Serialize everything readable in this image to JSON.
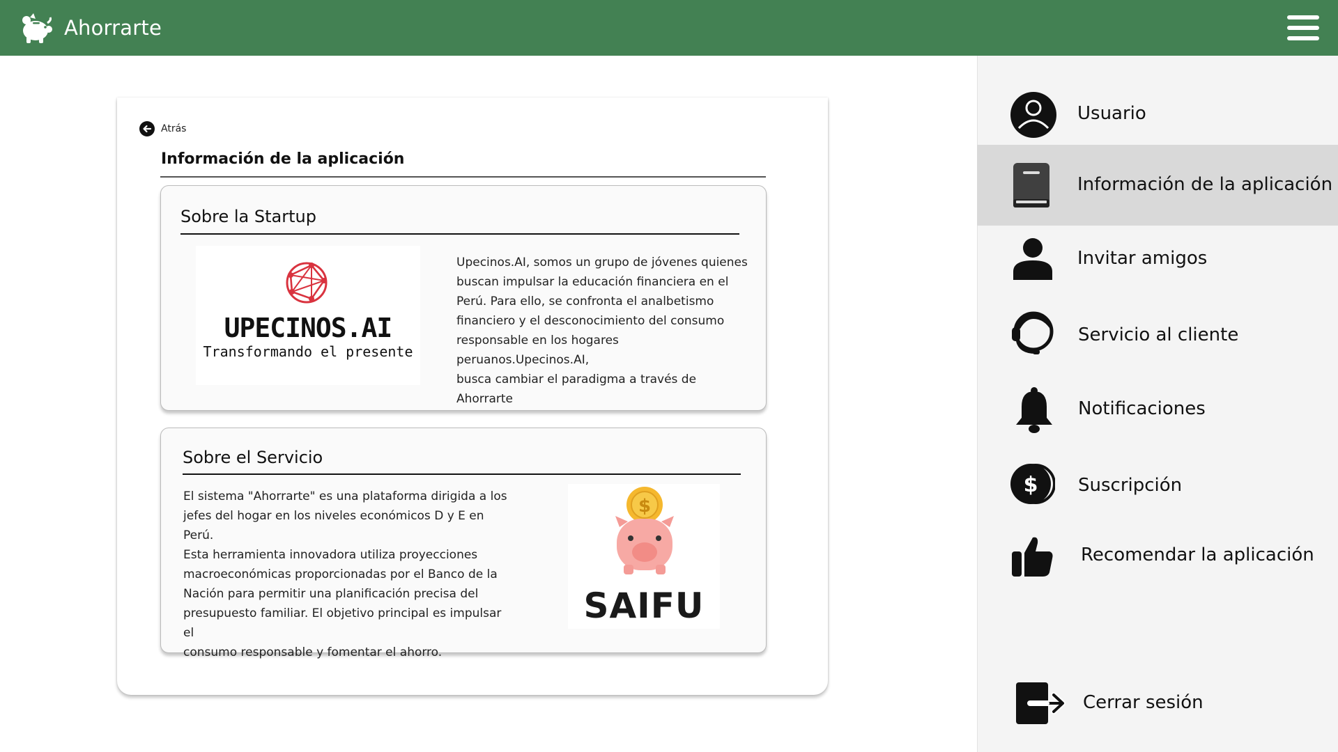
{
  "app": {
    "title": "Ahorrarte",
    "accent_color": "#438153"
  },
  "header": {
    "menu_icon": "hamburger-menu-icon"
  },
  "main": {
    "back_label": "Atrás",
    "page_title": "Información de la aplicación",
    "startup": {
      "title": "Sobre la Startup",
      "text_lines": [
        "Upecinos.AI, somos un grupo de jóvenes quienes",
        "buscan impulsar la educación financiera en el",
        "Perú. Para ello, se confronta el analbetismo",
        "financiero y el desconocimiento del consumo",
        "responsable en los hogares peruanos.Upecinos.AI,",
        "busca cambiar el paradigma a través de Ahorrarte"
      ],
      "logo": {
        "name": "UPECINOS.AI",
        "tagline": "Transformando el presente",
        "globe_color": "#d9333f"
      }
    },
    "service": {
      "title": "Sobre el Servicio",
      "text_lines": [
        "El sistema \"Ahorrarte\" es una plataforma dirigida a los",
        "jefes del hogar en los niveles económicos D y E en Perú.",
        "Esta herramienta innovadora utiliza proyecciones",
        "macroeconómicas proporcionadas por el Banco de la",
        "Nación para permitir una planificación precisa del",
        "presupuesto familiar. El objetivo principal es impulsar el",
        "consumo responsable y fomentar el ahorro."
      ],
      "logo": {
        "name": "SAIFU",
        "coin_symbol": "$",
        "pig_color": "#f7a9a4",
        "coin_color": "#f5b82e"
      }
    }
  },
  "sidebar": {
    "items": [
      {
        "label": "Usuario",
        "icon": "user-circle-icon",
        "active": false
      },
      {
        "label": "Información de la aplicación",
        "icon": "book-icon",
        "active": true
      },
      {
        "label": "Invitar amigos",
        "icon": "person-icon",
        "active": false
      },
      {
        "label": "Servicio al cliente",
        "icon": "headset-icon",
        "active": false
      },
      {
        "label": "Notificaciones",
        "icon": "bell-icon",
        "active": false
      },
      {
        "label": "Suscripción",
        "icon": "dollar-coin-icon",
        "active": false
      },
      {
        "label": "Recomendar la aplicación",
        "icon": "thumbs-up-icon",
        "active": false
      }
    ],
    "logout": {
      "label": "Cerrar sesión",
      "icon": "logout-icon"
    }
  }
}
